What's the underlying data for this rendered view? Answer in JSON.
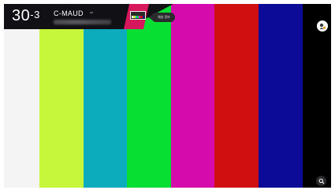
{
  "channel": {
    "number": "30",
    "sub_number": "-3",
    "name": "C-MAUD",
    "tag": "HD"
  },
  "tooltip": {
    "label": "채널 정보"
  },
  "test_pattern": {
    "bars": [
      {
        "name": "white",
        "color": "#f4f4f4"
      },
      {
        "name": "yellow-green",
        "color": "#c7f73a"
      },
      {
        "name": "cyan",
        "color": "#0cacbc"
      },
      {
        "name": "green",
        "color": "#07e033"
      },
      {
        "name": "magenta",
        "color": "#d60bac"
      },
      {
        "name": "red",
        "color": "#d01010"
      },
      {
        "name": "blue",
        "color": "#0b0b98"
      },
      {
        "name": "black",
        "color": "#000000"
      }
    ]
  },
  "icons": {
    "ai_button": "ai-assistant-icon",
    "search_button": "search-icon"
  },
  "colors": {
    "banner_bg": "#101015",
    "banner_accent": "#d6175b"
  }
}
